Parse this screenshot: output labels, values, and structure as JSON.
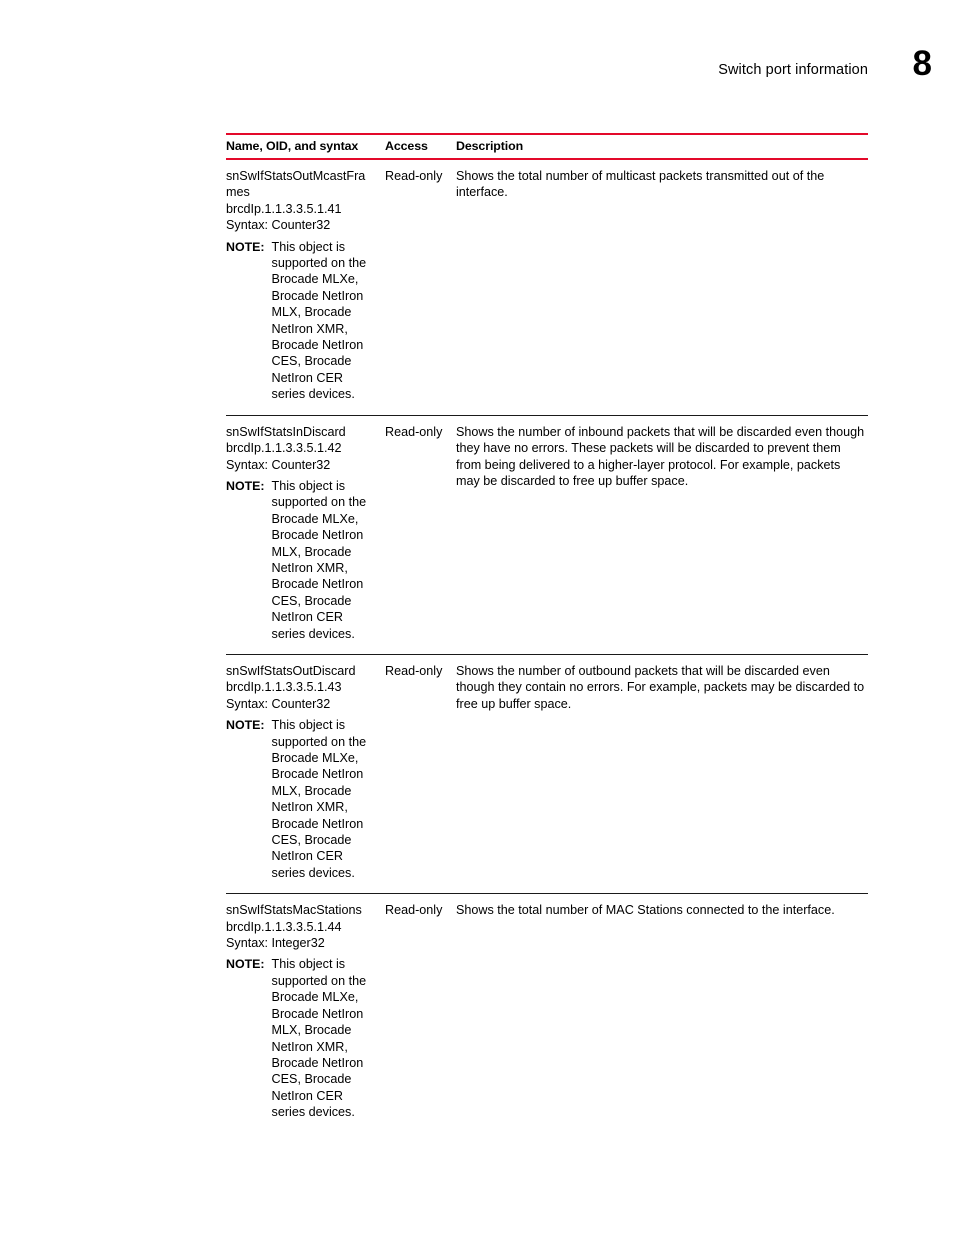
{
  "header": {
    "title": "Switch port information",
    "chapter_number": "8"
  },
  "table": {
    "columns": [
      "Name, OID, and syntax",
      "Access",
      "Description"
    ],
    "rows": [
      {
        "name": "snSwIfStatsOutMcastFrames",
        "oid": "brcdIp.1.1.3.3.5.1.41",
        "syntax": "Syntax: Counter32",
        "note_label": "NOTE:",
        "note_text": "This object is supported on the Brocade MLXe, Brocade NetIron MLX, Brocade NetIron XMR, Brocade NetIron CES, Brocade NetIron CER series devices.",
        "access": "Read-only",
        "description": "Shows the total number of multicast packets transmitted out of the interface."
      },
      {
        "name": "snSwIfStatsInDiscard",
        "oid": "brcdIp.1.1.3.3.5.1.42",
        "syntax": "Syntax: Counter32",
        "note_label": "NOTE:",
        "note_text": "This object is supported on the Brocade MLXe, Brocade NetIron MLX, Brocade NetIron XMR, Brocade NetIron CES, Brocade NetIron CER series devices.",
        "access": "Read-only",
        "description": "Shows the number of inbound packets that will be discarded even though they have no errors. These packets will be discarded to prevent them from being delivered to a higher-layer protocol. For example, packets may be discarded to free up buffer space."
      },
      {
        "name": "snSwIfStatsOutDiscard",
        "oid": "brcdIp.1.1.3.3.5.1.43",
        "syntax": "Syntax: Counter32",
        "note_label": "NOTE:",
        "note_text": "This object is supported on the Brocade MLXe, Brocade NetIron MLX, Brocade NetIron XMR, Brocade NetIron CES, Brocade NetIron CER series devices.",
        "access": "Read-only",
        "description": "Shows the number of outbound packets that will be discarded even though they contain no errors. For example, packets may be discarded to free up buffer space."
      },
      {
        "name": "snSwIfStatsMacStations",
        "oid": "brcdIp.1.1.3.3.5.1.44",
        "syntax": "Syntax: Integer32",
        "note_label": "NOTE:",
        "note_text": "This object is supported on the Brocade MLXe, Brocade NetIron MLX, Brocade NetIron XMR, Brocade NetIron CES, Brocade NetIron CER series devices.",
        "access": "Read-only",
        "description": "Shows the total number of MAC Stations connected to the interface."
      }
    ]
  },
  "colors": {
    "rule_red": "#e3092a",
    "row_rule": "#1a1a1a",
    "text": "#000000"
  }
}
